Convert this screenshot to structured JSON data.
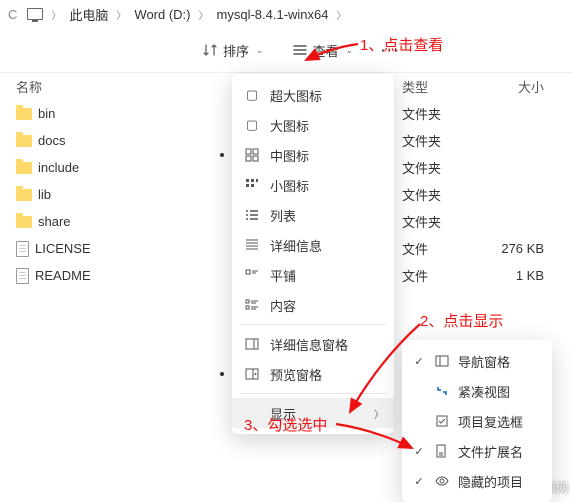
{
  "breadcrumb": {
    "reload_hint": "C",
    "items": [
      "此电脑",
      "Word (D:)",
      "mysql-8.4.1-winx64"
    ]
  },
  "toolbar": {
    "sort": "排序",
    "view": "查看",
    "more": "···"
  },
  "columns": {
    "name": "名称",
    "type": "类型",
    "size": "大小"
  },
  "files": [
    {
      "name": "bin",
      "icon": "folder",
      "type": "文件夹",
      "size": ""
    },
    {
      "name": "docs",
      "icon": "folder",
      "type": "文件夹",
      "size": ""
    },
    {
      "name": "include",
      "icon": "folder",
      "type": "文件夹",
      "size": ""
    },
    {
      "name": "lib",
      "icon": "folder",
      "type": "文件夹",
      "size": ""
    },
    {
      "name": "share",
      "icon": "folder",
      "type": "文件夹",
      "size": ""
    },
    {
      "name": "LICENSE",
      "icon": "doc",
      "type": "文件",
      "size": "276 KB"
    },
    {
      "name": "README",
      "icon": "doc",
      "type": "文件",
      "size": "1 KB"
    }
  ],
  "view_menu": {
    "xl_icons": "超大图标",
    "l_icons": "大图标",
    "m_icons": "中图标",
    "s_icons": "小图标",
    "list": "列表",
    "details": "详细信息",
    "tiles": "平铺",
    "content": "内容",
    "details_pane": "详细信息窗格",
    "preview_pane": "预览窗格",
    "show": "显示"
  },
  "show_menu": {
    "nav_pane": "导航窗格",
    "compact": "紧凑视图",
    "checkboxes": "项目复选框",
    "extensions": "文件扩展名",
    "hidden": "隐藏的项目"
  },
  "annotations": {
    "a1": "1、点击查看",
    "a2": "2、点击显示",
    "a3": "3、勾选选中"
  },
  "watermark": "高唐安卓网"
}
